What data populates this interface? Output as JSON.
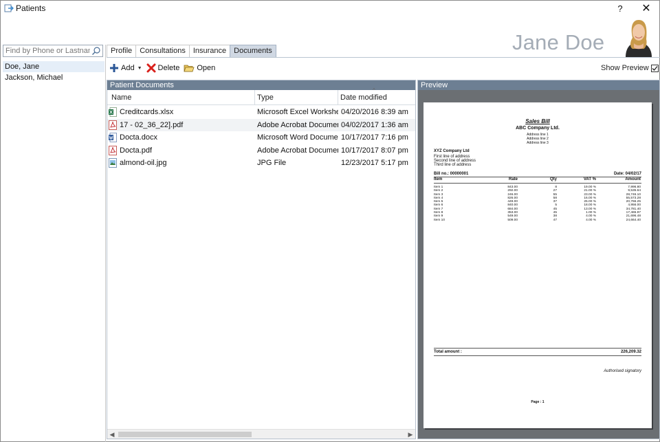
{
  "window": {
    "title": "Patients",
    "help_label": "?",
    "close_label": "✕"
  },
  "search": {
    "placeholder": "Find by Phone or Lastname",
    "value": ""
  },
  "patients": [
    {
      "name": "Doe, Jane",
      "selected": true
    },
    {
      "name": "Jackson, Michael",
      "selected": false
    }
  ],
  "tabs": [
    {
      "label": "Profile",
      "active": false
    },
    {
      "label": "Consultations",
      "active": false
    },
    {
      "label": "Insurance",
      "active": false
    },
    {
      "label": "Documents",
      "active": true
    }
  ],
  "patient_header": {
    "name": "Jane Doe"
  },
  "toolbar": {
    "add_label": "Add",
    "delete_label": "Delete",
    "open_label": "Open"
  },
  "show_preview": {
    "label": "Show Preview",
    "checked": true
  },
  "documents": {
    "title": "Patient Documents",
    "columns": {
      "name": "Name",
      "type": "Type",
      "date": "Date modified"
    },
    "rows": [
      {
        "icon": "excel-file-icon",
        "name": "Creditcards.xlsx",
        "type": "Microsoft Excel Worksheet",
        "date": "04/20/2016  8:39 am"
      },
      {
        "icon": "pdf-file-icon",
        "name": "17 - 02_36_22].pdf",
        "type": "Adobe Acrobat Document",
        "date": "04/02/2017  1:36 am"
      },
      {
        "icon": "word-file-icon",
        "name": "Docta.docx",
        "type": "Microsoft Word Docume…",
        "date": "10/17/2017  7:16 pm"
      },
      {
        "icon": "pdf-file-icon",
        "name": "Docta.pdf",
        "type": "Adobe Acrobat Document",
        "date": "10/17/2017  8:07 pm"
      },
      {
        "icon": "image-file-icon",
        "name": "almond-oil.jpg",
        "type": "JPG File",
        "date": "12/23/2017  5:17 pm"
      }
    ]
  },
  "preview": {
    "title": "Preview",
    "bill": {
      "heading": "Sales Bill",
      "company": "ABC Company Ltd.",
      "company_address": [
        "Address line 1",
        "Address line 2",
        "Address line 3"
      ],
      "client": "XYZ Company Ltd",
      "client_address": [
        "First line of address",
        "Second line of address",
        "Third line of address"
      ],
      "bill_no": "Bill no.: 00000001",
      "date": "Date: 04/02/17",
      "headers": [
        "Item",
        "Rate",
        "Qty",
        "VAT %",
        "Amount"
      ],
      "items": [
        [
          "Item 1",
          "843.00",
          "8",
          "19.00 %",
          "7,996.80"
        ],
        [
          "Item 2",
          "292.00",
          "27",
          "21.00 %",
          "9,535.64"
        ],
        [
          "Item 3",
          "246.00",
          "55",
          "23.00 %",
          "28,746.10"
        ],
        [
          "Item 4",
          "826.00",
          "58",
          "16.00 %",
          "55,573.28"
        ],
        [
          "Item 5",
          "449.00",
          "37",
          "25.00 %",
          "20,766.25"
        ],
        [
          "Item 6",
          "840.00",
          "5",
          "18.00 %",
          "4,956.00"
        ],
        [
          "Item 7",
          "684.00",
          "45",
          "13.00 %",
          "34,781.40"
        ],
        [
          "Item 8",
          "353.00",
          "45",
          "1.00 %",
          "17,465.97"
        ],
        [
          "Item 9",
          "549.00",
          "38",
          "4.00 %",
          "21,696.48"
        ],
        [
          "Item 10",
          "509.00",
          "47",
          "4.00 %",
          "24,664.40"
        ]
      ],
      "total_label": "Total amount :",
      "total_value": "226,209.32",
      "signatory": "Authorised signatory",
      "page_label": "Page : 1"
    }
  },
  "colors": {
    "panel_header": "#6d7f93",
    "selected_row": "#e5eef8",
    "name_text": "#a4acb6",
    "delete_red": "#d9211c",
    "add_blue": "#2b5797"
  }
}
